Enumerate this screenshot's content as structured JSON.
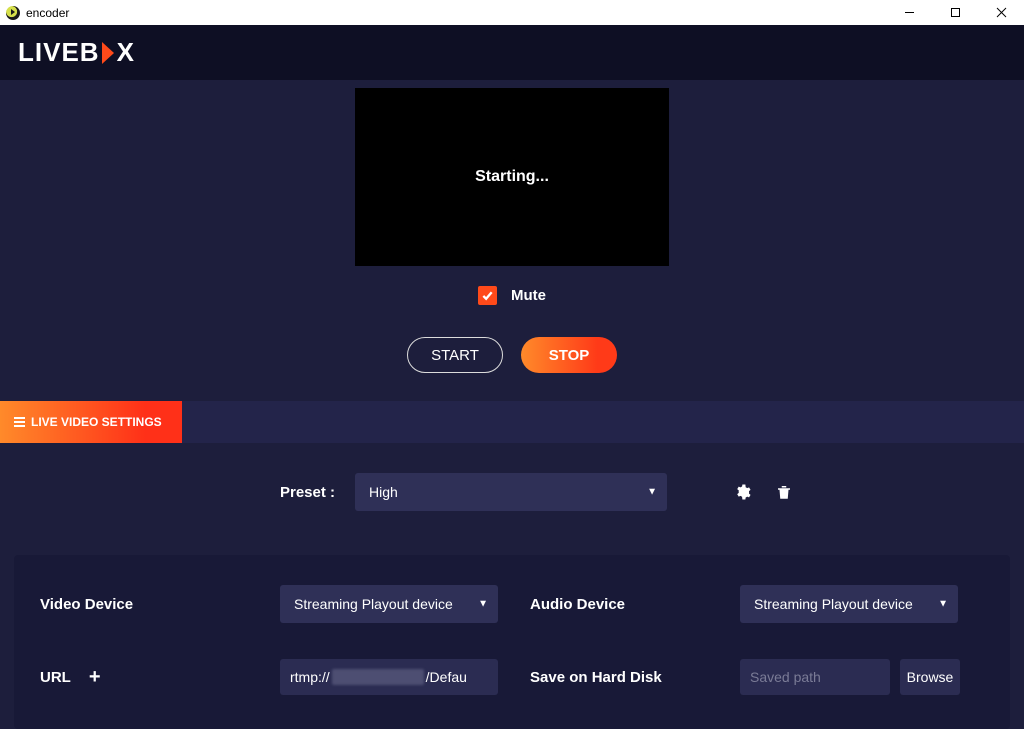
{
  "window": {
    "title": "encoder"
  },
  "logo": {
    "live": "LIVEB",
    "ox": "X"
  },
  "preview": {
    "status_text": "Starting..."
  },
  "controls": {
    "mute_label": "Mute",
    "mute_checked": true,
    "start_label": "START",
    "stop_label": "STOP"
  },
  "settings_tab": {
    "label": "LIVE VIDEO SETTINGS"
  },
  "preset": {
    "label": "Preset :",
    "selected": "High"
  },
  "form": {
    "video_device_label": "Video Device",
    "video_device_value": "Streaming Playout device",
    "audio_device_label": "Audio Device",
    "audio_device_value": "Streaming Playout device",
    "url_label": "URL",
    "url_prefix": "rtmp://",
    "url_suffix": "/Defau",
    "save_label": "Save on Hard Disk",
    "save_placeholder": "Saved path",
    "browse_label": "Browse"
  }
}
